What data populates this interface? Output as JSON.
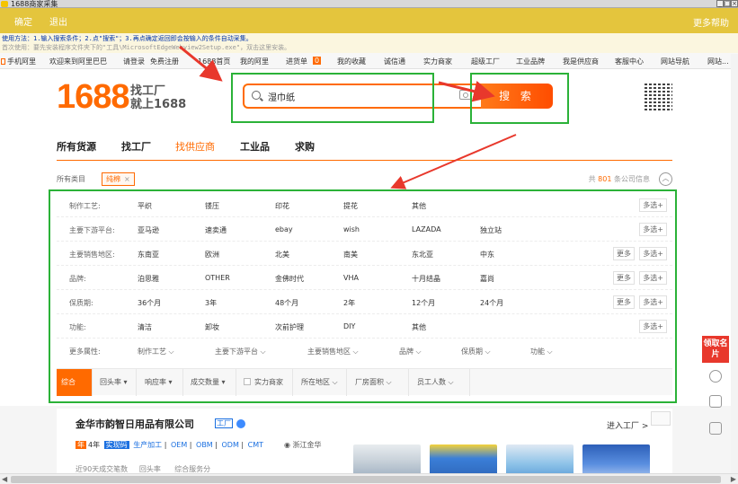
{
  "window": {
    "title": "1688商家采集",
    "controls": [
      "_",
      "□",
      "×"
    ]
  },
  "toolbar": {
    "confirm_label": "确定",
    "exit_label": "退出",
    "help_label": "更多帮助"
  },
  "instructions": {
    "line1": "使用方法：1.输入搜索条件；2.点\"搜索\"；3.再点确定返回即会按输入的条件自动采集。",
    "line2": "首次使用：要先安装程序文件夹下的\"工具\\MicrosoftEdgeWebview2Setup.exe\"，双击这里安装。"
  },
  "topnav": {
    "items": [
      "手机阿里",
      "欢迎来到阿里巴巴",
      "请登录",
      "免费注册",
      "1688首页",
      "我的阿里",
      "进货单",
      "0",
      "我的收藏",
      "诚信通",
      "实力商家",
      "超级工厂",
      "工业品牌",
      "我是供应商",
      "客服中心",
      "网站导航",
      "网站..."
    ]
  },
  "header": {
    "logo_number": "1688",
    "logo_slogan_1": "找工厂",
    "logo_slogan_2": "就上1688",
    "search_value": "湿巾纸",
    "search_button": "搜 索"
  },
  "tabs": [
    "所有货源",
    "找工厂",
    "找供应商",
    "工业品",
    "求购"
  ],
  "active_tab": "找供应商",
  "crumb": {
    "label": "所有类目",
    "chip": "纯棉",
    "chip_close": "×",
    "count_prefix": "共",
    "count": "801",
    "count_suffix": "条公司信息",
    "collapse": "︿"
  },
  "filters": [
    {
      "label": "制作工艺:",
      "options": [
        "平织",
        "镂压",
        "印花",
        "提花",
        "其他"
      ],
      "more": "",
      "multi": "多选+"
    },
    {
      "label": "主要下游平台:",
      "options": [
        "亚马逊",
        "速卖通",
        "ebay",
        "wish",
        "LAZADA",
        "独立站"
      ],
      "more": "",
      "multi": "多选+"
    },
    {
      "label": "主要销售地区:",
      "options": [
        "东南亚",
        "欧洲",
        "北美",
        "南美",
        "东北亚",
        "中东"
      ],
      "more": "更多",
      "multi": "多选+"
    },
    {
      "label": "品牌:",
      "options": [
        "泊思雅",
        "OTHER",
        "金佛时代",
        "VHA",
        "十月结晶",
        "嘉尚"
      ],
      "more": "更多",
      "multi": "多选+"
    },
    {
      "label": "保质期:",
      "options": [
        "36个月",
        "3年",
        "48个月",
        "2年",
        "12个月",
        "24个月"
      ],
      "more": "更多",
      "multi": "多选+"
    },
    {
      "label": "功能:",
      "options": [
        "清洁",
        "卸妆",
        "次前护理",
        "DIY",
        "其他"
      ],
      "more": "",
      "multi": "多选+"
    }
  ],
  "more_props": {
    "label": "更多属性:",
    "items": [
      "制作工艺",
      "主要下游平台",
      "主要销售地区",
      "品牌",
      "保质期",
      "功能"
    ]
  },
  "sortbar": [
    "综合",
    "回头率",
    "响应率",
    "成交数量",
    "实力商家",
    "所在地区",
    "厂房面积",
    "员工人数"
  ],
  "company": {
    "name": "金华市韵智日用品有限公司",
    "factory_badge": "工厂",
    "enter_label": "进入工厂 >",
    "years": "年",
    "years_num": "4年",
    "tag": "实现码",
    "meta": [
      "生产加工",
      "OEM",
      "OBM",
      "ODM",
      "CMT"
    ],
    "location": "浙江金华",
    "stats": [
      "近90天成交笔数",
      "回头率",
      "综合服务分"
    ]
  },
  "side": {
    "card_label": "领取名片"
  },
  "annotation_color": "#2bb238",
  "arrow_color": "#e8382c",
  "accent": "#ff6a00"
}
